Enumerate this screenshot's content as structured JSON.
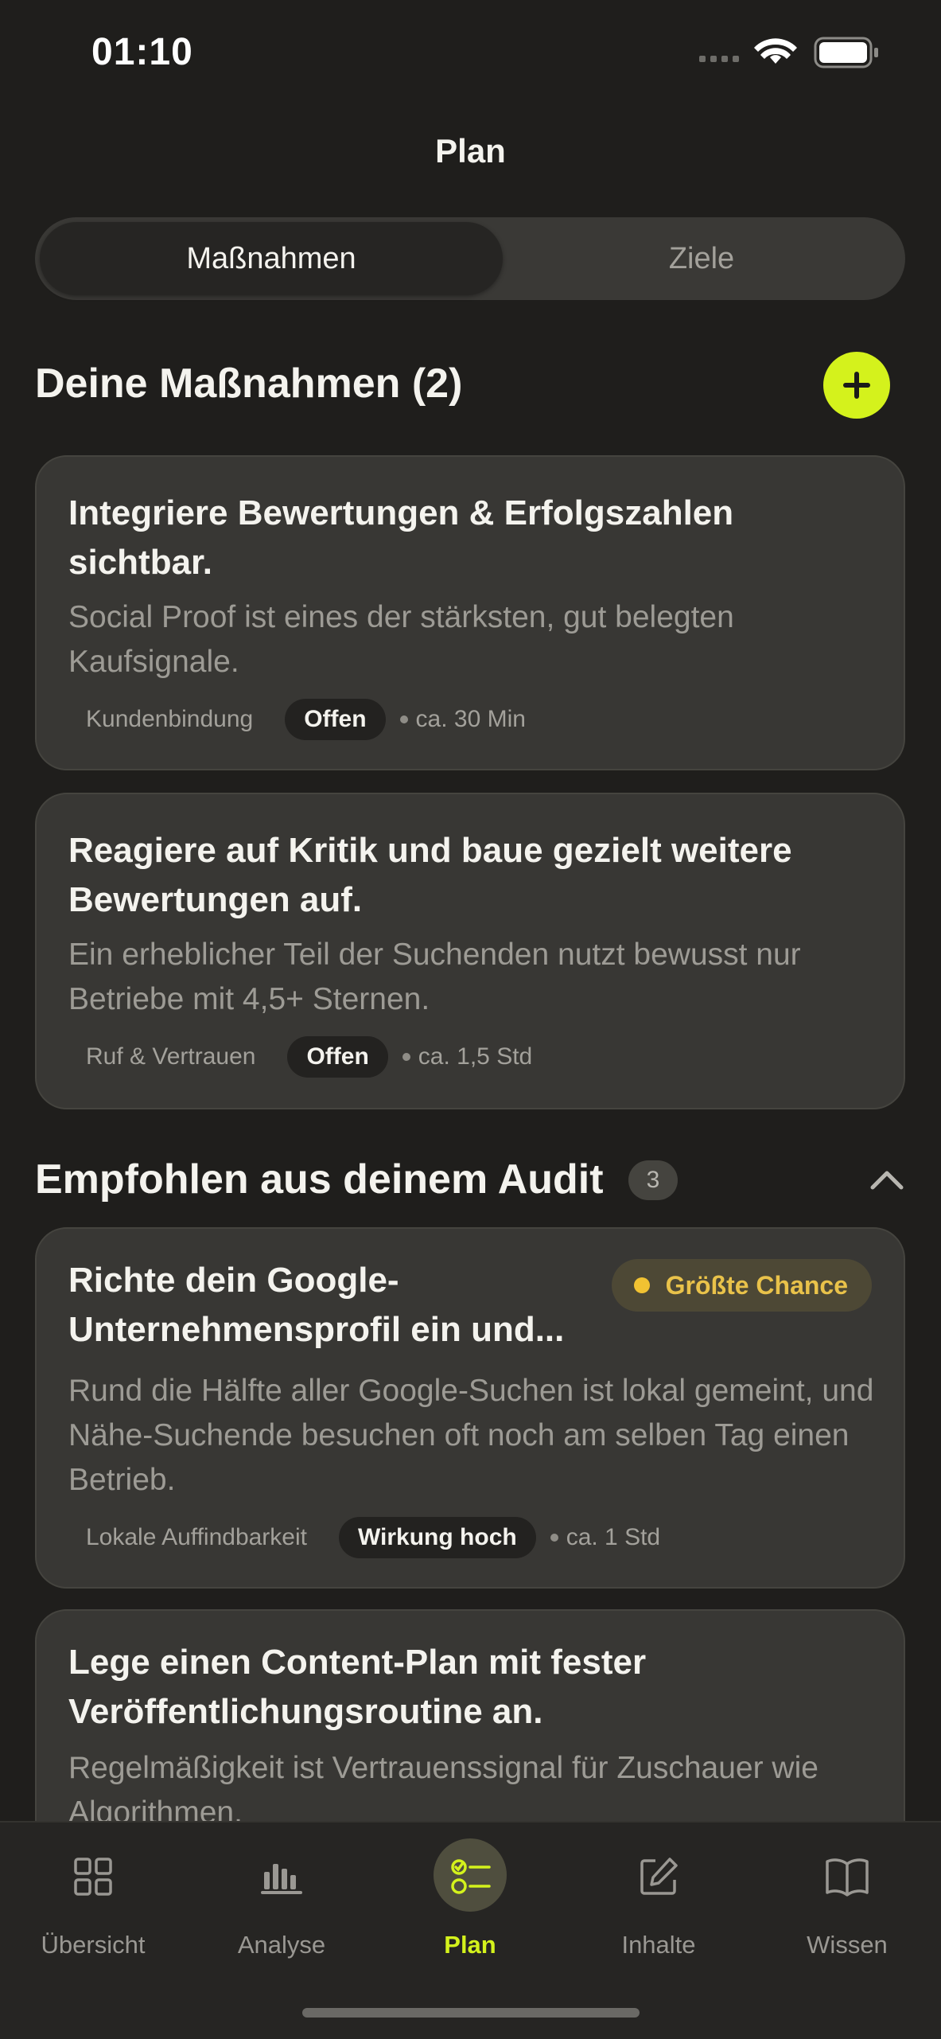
{
  "status_bar": {
    "time": "01:10"
  },
  "header": {
    "title": "Plan"
  },
  "segmented": {
    "active": "Maßnahmen",
    "inactive": "Ziele"
  },
  "my_actions": {
    "title": "Deine Maßnahmen (2)",
    "cards": [
      {
        "title": "Integriere Bewertungen & Erfolgszahlen sichtbar.",
        "desc": "Social Proof ist eines der stärksten, gut belegten Kaufsignale.",
        "category": "Kundenbindung",
        "status": "Offen",
        "duration": "ca. 30 Min"
      },
      {
        "title": "Reagiere auf Kritik und baue gezielt weitere Bewertungen auf.",
        "desc": "Ein erheblicher Teil der Suchenden nutzt bewusst nur Betriebe mit 4,5+ Sternen.",
        "category": "Ruf & Vertrauen",
        "status": "Offen",
        "duration": "ca. 1,5 Std"
      }
    ]
  },
  "recommended": {
    "title": "Empfohlen aus deinem Audit",
    "count": "3",
    "cards": [
      {
        "title": "Richte dein Google-Unternehmensprofil ein und...",
        "badge": "Größte Chance",
        "desc": "Rund die Hälfte aller Google-Suchen ist lokal gemeint, und Nähe-Suchende besuchen oft noch am selben Tag einen Betrieb.",
        "category": "Lokale Auffindbarkeit",
        "impact": "Wirkung hoch",
        "duration": "ca. 1 Std"
      },
      {
        "title": "Lege einen Content-Plan mit fester Veröffentlichungsroutine an.",
        "desc": "Regelmäßigkeit ist Vertrauenssignal für Zuschauer wie Algorithmen."
      }
    ]
  },
  "nav": [
    {
      "label": "Übersicht",
      "icon": "grid-icon"
    },
    {
      "label": "Analyse",
      "icon": "bar-chart-icon"
    },
    {
      "label": "Plan",
      "icon": "checklist-icon"
    },
    {
      "label": "Inhalte",
      "icon": "edit-icon"
    },
    {
      "label": "Wissen",
      "icon": "book-icon"
    }
  ],
  "colors": {
    "accent": "#d4f21c",
    "background": "#1f1e1c",
    "card": "#383734",
    "highlight": "#f1c232"
  }
}
